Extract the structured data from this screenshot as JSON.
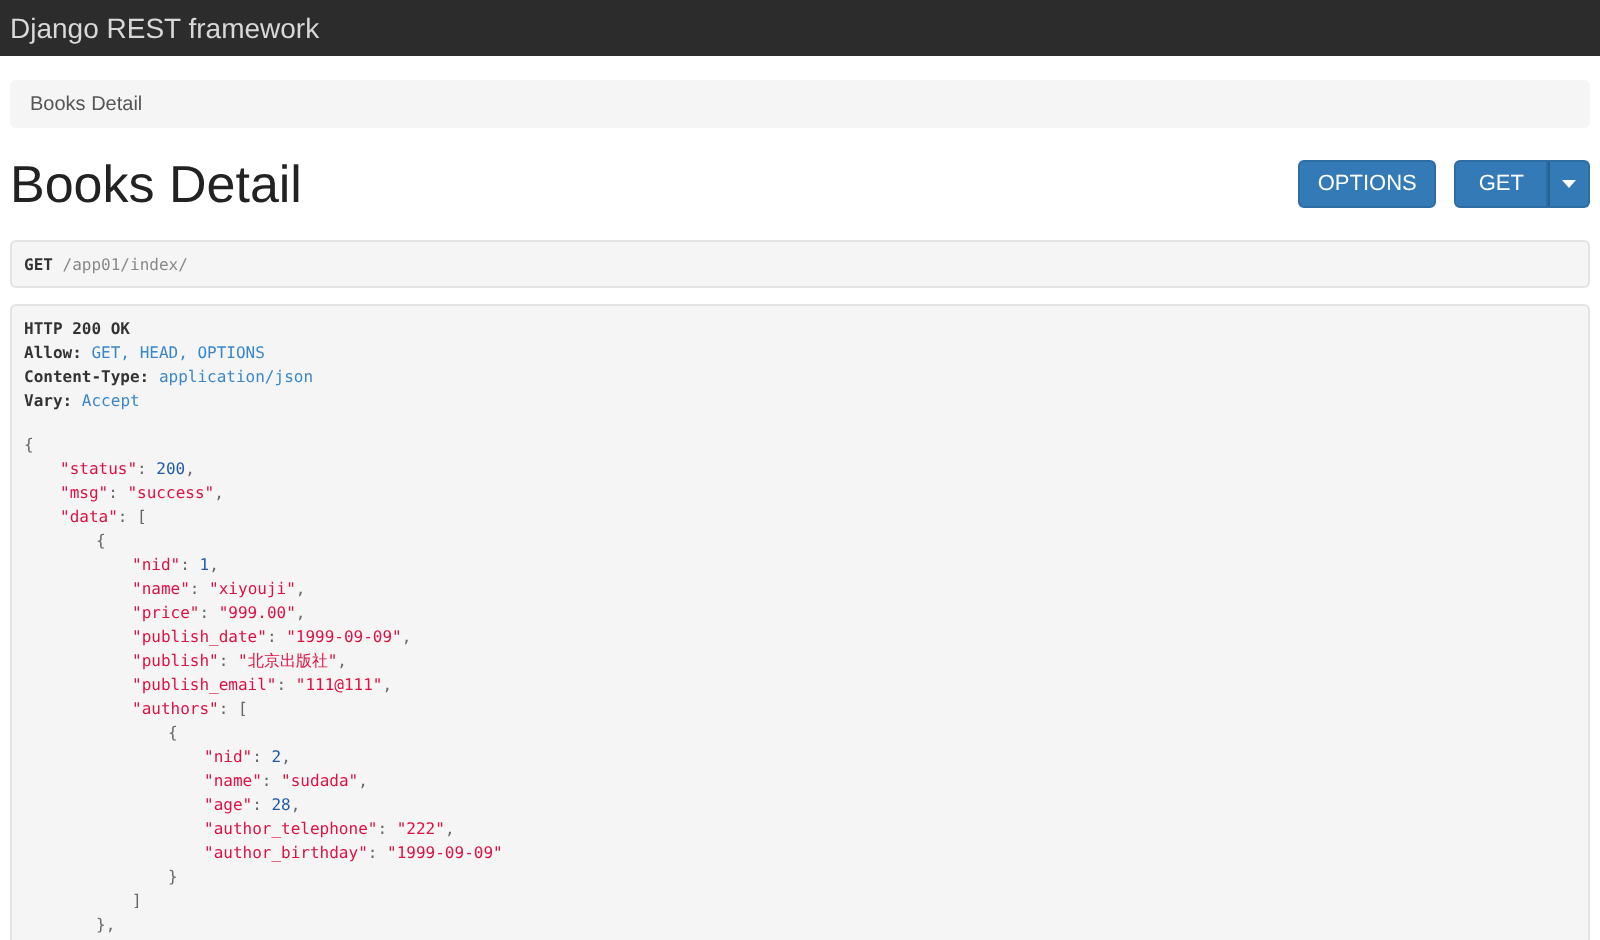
{
  "navbar": {
    "brand": "Django REST framework"
  },
  "breadcrumb": {
    "items": [
      {
        "label": "Books Detail",
        "selected": true
      }
    ]
  },
  "page_title": "Books Detail",
  "buttons": [
    {
      "label": "OPTIONS",
      "kind": "plain"
    },
    {
      "label": "GET",
      "kind": "split"
    }
  ],
  "request": {
    "method": "GET",
    "path": "/app01/index/"
  },
  "response": {
    "status": "HTTP 200 OK",
    "headers": [
      {
        "name": "Allow:",
        "value": "GET, HEAD, OPTIONS"
      },
      {
        "name": "Content-Type:",
        "value": "application/json"
      },
      {
        "name": "Vary:",
        "value": "Accept"
      }
    ],
    "body": [
      {
        "tokens": [
          {
            "kind": "punct",
            "text": "{"
          }
        ],
        "children": [
          {
            "tokens": [
              {
                "kind": "key",
                "text": "\"status\""
              },
              {
                "kind": "punct",
                "text": ": "
              },
              {
                "kind": "num",
                "text": "200"
              },
              {
                "kind": "punct",
                "text": ","
              }
            ]
          },
          {
            "tokens": [
              {
                "kind": "key",
                "text": "\"msg\""
              },
              {
                "kind": "punct",
                "text": ": "
              },
              {
                "kind": "str",
                "text": "\"success\""
              },
              {
                "kind": "punct",
                "text": ","
              }
            ]
          },
          {
            "tokens": [
              {
                "kind": "key",
                "text": "\"data\""
              },
              {
                "kind": "punct",
                "text": ": ["
              }
            ],
            "children": [
              {
                "tokens": [
                  {
                    "kind": "punct",
                    "text": "{"
                  }
                ],
                "children": [
                  {
                    "tokens": [
                      {
                        "kind": "key",
                        "text": "\"nid\""
                      },
                      {
                        "kind": "punct",
                        "text": ": "
                      },
                      {
                        "kind": "num",
                        "text": "1"
                      },
                      {
                        "kind": "punct",
                        "text": ","
                      }
                    ]
                  },
                  {
                    "tokens": [
                      {
                        "kind": "key",
                        "text": "\"name\""
                      },
                      {
                        "kind": "punct",
                        "text": ": "
                      },
                      {
                        "kind": "str",
                        "text": "\"xiyouji\""
                      },
                      {
                        "kind": "punct",
                        "text": ","
                      }
                    ]
                  },
                  {
                    "tokens": [
                      {
                        "kind": "key",
                        "text": "\"price\""
                      },
                      {
                        "kind": "punct",
                        "text": ": "
                      },
                      {
                        "kind": "str",
                        "text": "\"999.00\""
                      },
                      {
                        "kind": "punct",
                        "text": ","
                      }
                    ]
                  },
                  {
                    "tokens": [
                      {
                        "kind": "key",
                        "text": "\"publish_date\""
                      },
                      {
                        "kind": "punct",
                        "text": ": "
                      },
                      {
                        "kind": "str",
                        "text": "\"1999-09-09\""
                      },
                      {
                        "kind": "punct",
                        "text": ","
                      }
                    ]
                  },
                  {
                    "tokens": [
                      {
                        "kind": "key",
                        "text": "\"publish\""
                      },
                      {
                        "kind": "punct",
                        "text": ": "
                      },
                      {
                        "kind": "str",
                        "text": "\"北京出版社\""
                      },
                      {
                        "kind": "punct",
                        "text": ","
                      }
                    ]
                  },
                  {
                    "tokens": [
                      {
                        "kind": "key",
                        "text": "\"publish_email\""
                      },
                      {
                        "kind": "punct",
                        "text": ": "
                      },
                      {
                        "kind": "str",
                        "text": "\"111@111\""
                      },
                      {
                        "kind": "punct",
                        "text": ","
                      }
                    ]
                  },
                  {
                    "tokens": [
                      {
                        "kind": "key",
                        "text": "\"authors\""
                      },
                      {
                        "kind": "punct",
                        "text": ": ["
                      }
                    ],
                    "children": [
                      {
                        "tokens": [
                          {
                            "kind": "punct",
                            "text": "{"
                          }
                        ],
                        "children": [
                          {
                            "tokens": [
                              {
                                "kind": "key",
                                "text": "\"nid\""
                              },
                              {
                                "kind": "punct",
                                "text": ": "
                              },
                              {
                                "kind": "num",
                                "text": "2"
                              },
                              {
                                "kind": "punct",
                                "text": ","
                              }
                            ]
                          },
                          {
                            "tokens": [
                              {
                                "kind": "key",
                                "text": "\"name\""
                              },
                              {
                                "kind": "punct",
                                "text": ": "
                              },
                              {
                                "kind": "str",
                                "text": "\"sudada\""
                              },
                              {
                                "kind": "punct",
                                "text": ","
                              }
                            ]
                          },
                          {
                            "tokens": [
                              {
                                "kind": "key",
                                "text": "\"age\""
                              },
                              {
                                "kind": "punct",
                                "text": ": "
                              },
                              {
                                "kind": "num",
                                "text": "28"
                              },
                              {
                                "kind": "punct",
                                "text": ","
                              }
                            ]
                          },
                          {
                            "tokens": [
                              {
                                "kind": "key",
                                "text": "\"author_telephone\""
                              },
                              {
                                "kind": "punct",
                                "text": ": "
                              },
                              {
                                "kind": "str",
                                "text": "\"222\""
                              },
                              {
                                "kind": "punct",
                                "text": ","
                              }
                            ]
                          },
                          {
                            "tokens": [
                              {
                                "kind": "key",
                                "text": "\"author_birthday\""
                              },
                              {
                                "kind": "punct",
                                "text": ": "
                              },
                              {
                                "kind": "str",
                                "text": "\"1999-09-09\""
                              }
                            ]
                          }
                        ]
                      },
                      {
                        "tokens": [
                          {
                            "kind": "punct",
                            "text": "}"
                          }
                        ]
                      }
                    ]
                  },
                  {
                    "tokens": [
                      {
                        "kind": "punct",
                        "text": "]"
                      }
                    ]
                  }
                ]
              },
              {
                "tokens": [
                  {
                    "kind": "punct",
                    "text": "},"
                  }
                ]
              }
            ]
          }
        ]
      }
    ]
  }
}
